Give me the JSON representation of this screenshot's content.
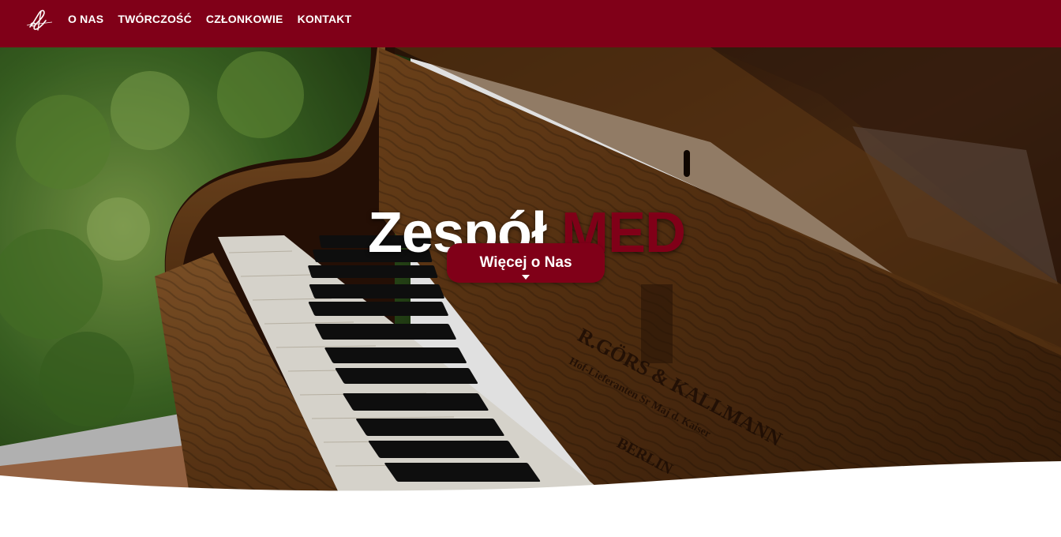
{
  "nav": {
    "logo_icon": "treble-clef-logo-icon",
    "links": [
      {
        "label": "O NAS"
      },
      {
        "label": "TWÓRCZOŚĆ"
      },
      {
        "label": "CZŁONKOWIE"
      },
      {
        "label": "KONTAKT"
      }
    ]
  },
  "hero": {
    "title_main": "Zespół",
    "title_accent": "MED",
    "cta_label": "Więcej o Nas",
    "cta_icon": "caret-down-icon",
    "background_image": "grand-piano-photo"
  },
  "colors": {
    "brand": "#800018",
    "text_on_brand": "#ffffff"
  }
}
